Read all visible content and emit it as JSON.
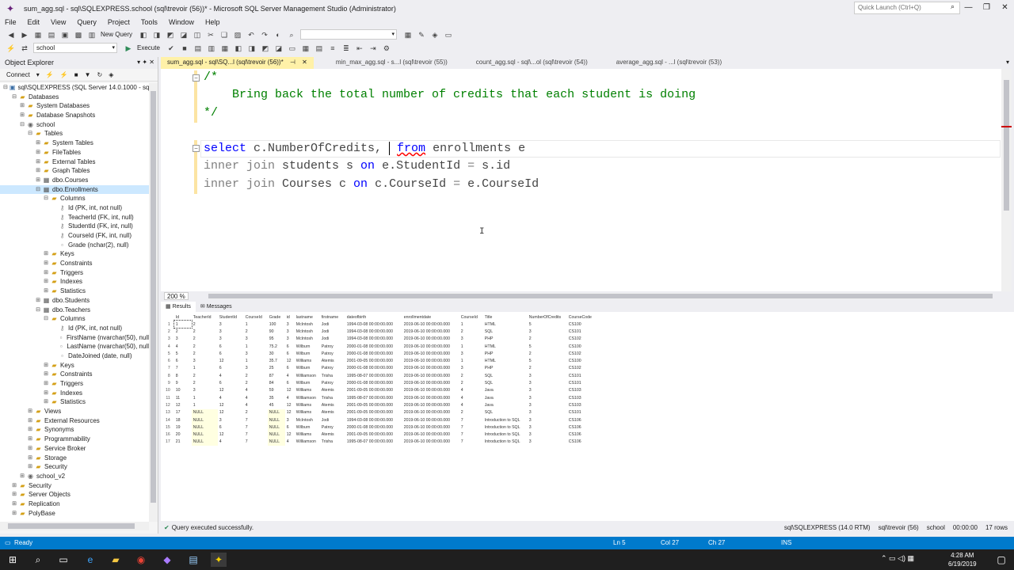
{
  "window": {
    "title": "sum_agg.sql - sql\\SQLEXPRESS.school (sql\\trevoir (56))* - Microsoft SQL Server Management Studio (Administrator)",
    "quick_launch_placeholder": "Quick Launch (Ctrl+Q)"
  },
  "menu": [
    "File",
    "Edit",
    "View",
    "Query",
    "Project",
    "Tools",
    "Window",
    "Help"
  ],
  "toolbar": {
    "new_query": "New Query",
    "database": "school",
    "execute": "Execute"
  },
  "object_explorer": {
    "title": "Object Explorer",
    "connect": "Connect",
    "tree": [
      {
        "label": "sql\\SQLEXPRESS (SQL Server 14.0.1000 - sql\\t",
        "depth": 0,
        "exp": "−",
        "icon": "server"
      },
      {
        "label": "Databases",
        "depth": 1,
        "exp": "−",
        "icon": "folder"
      },
      {
        "label": "System Databases",
        "depth": 2,
        "exp": "+",
        "icon": "folder"
      },
      {
        "label": "Database Snapshots",
        "depth": 2,
        "exp": "+",
        "icon": "folder"
      },
      {
        "label": "school",
        "depth": 2,
        "exp": "−",
        "icon": "db"
      },
      {
        "label": "Tables",
        "depth": 3,
        "exp": "−",
        "icon": "folder"
      },
      {
        "label": "System Tables",
        "depth": 4,
        "exp": "+",
        "icon": "folder"
      },
      {
        "label": "FileTables",
        "depth": 4,
        "exp": "+",
        "icon": "folder"
      },
      {
        "label": "External Tables",
        "depth": 4,
        "exp": "+",
        "icon": "folder"
      },
      {
        "label": "Graph Tables",
        "depth": 4,
        "exp": "+",
        "icon": "folder"
      },
      {
        "label": "dbo.Courses",
        "depth": 4,
        "exp": "+",
        "icon": "table"
      },
      {
        "label": "dbo.Enrollments",
        "depth": 4,
        "exp": "−",
        "icon": "table",
        "selected": true
      },
      {
        "label": "Columns",
        "depth": 5,
        "exp": "−",
        "icon": "folder"
      },
      {
        "label": "Id (PK, int, not null)",
        "depth": 6,
        "exp": "",
        "icon": "key"
      },
      {
        "label": "TeacherId (FK, int, null)",
        "depth": 6,
        "exp": "",
        "icon": "key"
      },
      {
        "label": "StudentId (FK, int, null)",
        "depth": 6,
        "exp": "",
        "icon": "key"
      },
      {
        "label": "CourseId (FK, int, null)",
        "depth": 6,
        "exp": "",
        "icon": "key"
      },
      {
        "label": "Grade (nchar(2), null)",
        "depth": 6,
        "exp": "",
        "icon": "col"
      },
      {
        "label": "Keys",
        "depth": 5,
        "exp": "+",
        "icon": "folder"
      },
      {
        "label": "Constraints",
        "depth": 5,
        "exp": "+",
        "icon": "folder"
      },
      {
        "label": "Triggers",
        "depth": 5,
        "exp": "+",
        "icon": "folder"
      },
      {
        "label": "Indexes",
        "depth": 5,
        "exp": "+",
        "icon": "folder"
      },
      {
        "label": "Statistics",
        "depth": 5,
        "exp": "+",
        "icon": "folder"
      },
      {
        "label": "dbo.Students",
        "depth": 4,
        "exp": "+",
        "icon": "table"
      },
      {
        "label": "dbo.Teachers",
        "depth": 4,
        "exp": "−",
        "icon": "table"
      },
      {
        "label": "Columns",
        "depth": 5,
        "exp": "−",
        "icon": "folder"
      },
      {
        "label": "Id (PK, int, not null)",
        "depth": 6,
        "exp": "",
        "icon": "key"
      },
      {
        "label": "FirstName (nvarchar(50), null",
        "depth": 6,
        "exp": "",
        "icon": "col"
      },
      {
        "label": "LastName (nvarchar(50), null",
        "depth": 6,
        "exp": "",
        "icon": "col"
      },
      {
        "label": "DateJoined (date, null)",
        "depth": 6,
        "exp": "",
        "icon": "col"
      },
      {
        "label": "Keys",
        "depth": 5,
        "exp": "+",
        "icon": "folder"
      },
      {
        "label": "Constraints",
        "depth": 5,
        "exp": "+",
        "icon": "folder"
      },
      {
        "label": "Triggers",
        "depth": 5,
        "exp": "+",
        "icon": "folder"
      },
      {
        "label": "Indexes",
        "depth": 5,
        "exp": "+",
        "icon": "folder"
      },
      {
        "label": "Statistics",
        "depth": 5,
        "exp": "+",
        "icon": "folder"
      },
      {
        "label": "Views",
        "depth": 3,
        "exp": "+",
        "icon": "folder"
      },
      {
        "label": "External Resources",
        "depth": 3,
        "exp": "+",
        "icon": "folder"
      },
      {
        "label": "Synonyms",
        "depth": 3,
        "exp": "+",
        "icon": "folder"
      },
      {
        "label": "Programmability",
        "depth": 3,
        "exp": "+",
        "icon": "folder"
      },
      {
        "label": "Service Broker",
        "depth": 3,
        "exp": "+",
        "icon": "folder"
      },
      {
        "label": "Storage",
        "depth": 3,
        "exp": "+",
        "icon": "folder"
      },
      {
        "label": "Security",
        "depth": 3,
        "exp": "+",
        "icon": "folder"
      },
      {
        "label": "school_v2",
        "depth": 2,
        "exp": "+",
        "icon": "db"
      },
      {
        "label": "Security",
        "depth": 1,
        "exp": "+",
        "icon": "folder"
      },
      {
        "label": "Server Objects",
        "depth": 1,
        "exp": "+",
        "icon": "folder"
      },
      {
        "label": "Replication",
        "depth": 1,
        "exp": "+",
        "icon": "folder"
      },
      {
        "label": "PolyBase",
        "depth": 1,
        "exp": "+",
        "icon": "folder"
      }
    ]
  },
  "tabs": [
    {
      "label": "sum_agg.sql - sql\\SQ...l (sql\\trevoir (56))*",
      "active": true
    },
    {
      "label": "min_max_agg.sql - s...l (sql\\trevoir (55))",
      "active": false
    },
    {
      "label": "count_agg.sql - sql\\...ol (sql\\trevoir (54))",
      "active": false
    },
    {
      "label": "average_agg.sql - ...l (sql\\trevoir (53))",
      "active": false
    }
  ],
  "editor": {
    "lines": {
      "l1": "/*",
      "l2": "    Bring back the total number of credits that each student is doing",
      "l3": "*/",
      "l5a": "select",
      "l5b": " c.NumberOfCredits, ",
      "l5c": "from",
      "l5d": " enrollments e",
      "l6a": "inner join",
      "l6b": " students s ",
      "l6c": "on",
      "l6d": " e.StudentId ",
      "l6e": "=",
      "l6f": " s.id",
      "l7a": "inner join",
      "l7b": " Courses c ",
      "l7c": "on",
      "l7d": " c.CourseId ",
      "l7e": "=",
      "l7f": " e.CourseId"
    },
    "zoom": "200 %"
  },
  "results": {
    "tabs": [
      "Results",
      "Messages"
    ],
    "columns": [
      "Id",
      "TeacherId",
      "StudentId",
      "CourseId",
      "Grade",
      "id",
      "lastname",
      "firstname",
      "dateofbirth",
      "enrollmentdate",
      "CourseId",
      "Title",
      "NumberOfCredits",
      "CourseCode"
    ],
    "rows": [
      [
        "1",
        "2",
        "3",
        "1",
        "100",
        "3",
        "McIntosh",
        "Jodi",
        "1994-03-08 00:00:00.000",
        "2019-06-10 00:00:00.000",
        "1",
        "HTML",
        "5",
        "CS100"
      ],
      [
        "2",
        "2",
        "3",
        "2",
        "90",
        "3",
        "McIntosh",
        "Jodi",
        "1994-03-08 00:00:00.000",
        "2019-06-10 00:00:00.000",
        "2",
        "SQL",
        "3",
        "CS101"
      ],
      [
        "3",
        "2",
        "3",
        "3",
        "95",
        "3",
        "McIntosh",
        "Jodi",
        "1994-03-08 00:00:00.000",
        "2019-06-10 00:00:00.000",
        "3",
        "PHP",
        "2",
        "CS102"
      ],
      [
        "4",
        "2",
        "6",
        "1",
        "75.2",
        "6",
        "Wilburn",
        "Patroy",
        "2000-01-08 00:00:00.000",
        "2019-06-10 00:00:00.000",
        "1",
        "HTML",
        "5",
        "CS100"
      ],
      [
        "5",
        "2",
        "6",
        "3",
        "30",
        "6",
        "Wilburn",
        "Patroy",
        "2000-01-08 00:00:00.000",
        "2019-06-10 00:00:00.000",
        "3",
        "PHP",
        "2",
        "CS102"
      ],
      [
        "6",
        "3",
        "12",
        "1",
        "35.7",
        "12",
        "Williams",
        "Atemis",
        "2001-09-05 00:00:00.000",
        "2019-06-10 00:00:00.000",
        "1",
        "HTML",
        "5",
        "CS100"
      ],
      [
        "7",
        "1",
        "6",
        "3",
        "25",
        "6",
        "Wilburn",
        "Patroy",
        "2000-01-08 00:00:00.000",
        "2019-06-10 00:00:00.000",
        "3",
        "PHP",
        "2",
        "CS102"
      ],
      [
        "8",
        "2",
        "4",
        "2",
        "87",
        "4",
        "Williamson",
        "Trisha",
        "1995-08-07 00:00:00.000",
        "2019-06-10 00:00:00.000",
        "2",
        "SQL",
        "3",
        "CS101"
      ],
      [
        "9",
        "2",
        "6",
        "2",
        "84",
        "6",
        "Wilburn",
        "Patroy",
        "2000-01-08 00:00:00.000",
        "2019-06-10 00:00:00.000",
        "2",
        "SQL",
        "3",
        "CS101"
      ],
      [
        "10",
        "3",
        "12",
        "4",
        "59",
        "12",
        "Williams",
        "Atemis",
        "2001-09-05 00:00:00.000",
        "2019-06-10 00:00:00.000",
        "4",
        "Java",
        "3",
        "CS103"
      ],
      [
        "11",
        "1",
        "4",
        "4",
        "35",
        "4",
        "Williamson",
        "Trisha",
        "1995-08-07 00:00:00.000",
        "2019-06-10 00:00:00.000",
        "4",
        "Java",
        "3",
        "CS103"
      ],
      [
        "12",
        "1",
        "12",
        "4",
        "45",
        "12",
        "Williams",
        "Atemis",
        "2001-09-05 00:00:00.000",
        "2019-06-10 00:00:00.000",
        "4",
        "Java",
        "3",
        "CS103"
      ],
      [
        "17",
        "NULL",
        "12",
        "2",
        "NULL",
        "12",
        "Williams",
        "Atemis",
        "2001-09-05 00:00:00.000",
        "2019-06-10 00:00:00.000",
        "2",
        "SQL",
        "3",
        "CS101"
      ],
      [
        "18",
        "NULL",
        "3",
        "7",
        "NULL",
        "3",
        "McIntosh",
        "Jodi",
        "1994-03-08 00:00:00.000",
        "2019-06-10 00:00:00.000",
        "7",
        "Introduction to SQL",
        "3",
        "CS106"
      ],
      [
        "19",
        "NULL",
        "6",
        "7",
        "NULL",
        "6",
        "Wilburn",
        "Patroy",
        "2000-01-08 00:00:00.000",
        "2019-06-10 00:00:00.000",
        "7",
        "Introduction to SQL",
        "3",
        "CS106"
      ],
      [
        "20",
        "NULL",
        "12",
        "7",
        "NULL",
        "12",
        "Williams",
        "Atemis",
        "2001-09-05 00:00:00.000",
        "2019-06-10 00:00:00.000",
        "7",
        "Introduction to SQL",
        "3",
        "CS106"
      ],
      [
        "21",
        "NULL",
        "4",
        "7",
        "NULL",
        "4",
        "Williamson",
        "Trisha",
        "1995-08-07 00:00:00.000",
        "2019-06-10 00:00:00.000",
        "7",
        "Introduction to SQL",
        "3",
        "CS106"
      ]
    ]
  },
  "query_status": {
    "message": "Query executed successfully.",
    "server": "sql\\SQLEXPRESS (14.0 RTM)",
    "user": "sql\\trevoir (56)",
    "db": "school",
    "time": "00:00:00",
    "rows": "17 rows"
  },
  "statusbar": {
    "ready": "Ready",
    "ln": "Ln 5",
    "col": "Col 27",
    "ch": "Ch 27",
    "ins": "INS"
  },
  "taskbar": {
    "time": "4:28 AM",
    "date": "6/19/2019"
  }
}
